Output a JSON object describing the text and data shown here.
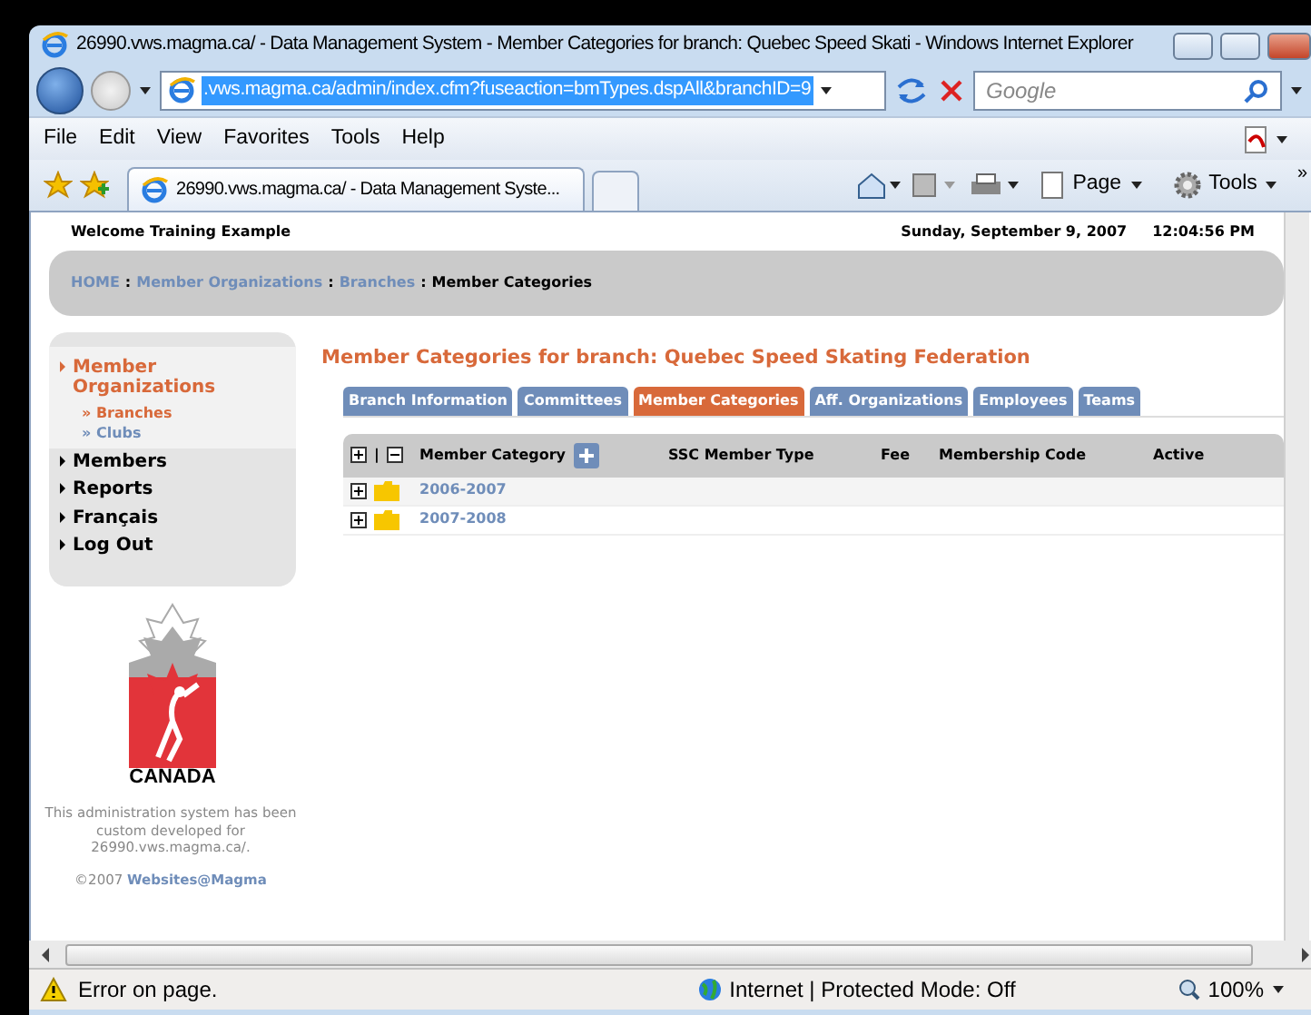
{
  "window": {
    "title": "26990.vws.magma.ca/ - Data Management System - Member Categories for branch: Quebec Speed Skati - Windows Internet Explorer"
  },
  "address_bar": {
    "url": ".vws.magma.ca/admin/index.cfm?fuseaction=bmTypes.dspAll&branchID=9"
  },
  "search": {
    "placeholder": "Google"
  },
  "menu": [
    "File",
    "Edit",
    "View",
    "Favorites",
    "Tools",
    "Help"
  ],
  "browser_tab": {
    "title": "26990.vws.magma.ca/ - Data Management Syste..."
  },
  "command_bar": {
    "page": "Page",
    "tools": "Tools",
    "more": "»"
  },
  "page": {
    "welcome": "Welcome Training Example",
    "date": "Sunday, September 9, 2007",
    "time": "12:04:56 PM",
    "breadcrumb": [
      {
        "label": "HOME",
        "link": true
      },
      {
        "label": "Member Organizations",
        "link": true
      },
      {
        "label": "Branches",
        "link": true
      },
      {
        "label": "Member Categories",
        "link": false
      }
    ],
    "breadcrumb_separator": ":",
    "sidebar": [
      {
        "label": "Member Organizations",
        "selected": true,
        "children": [
          {
            "label": "» Branches",
            "selected": true
          },
          {
            "label": "» Clubs",
            "selected": false
          }
        ]
      },
      {
        "label": "Members",
        "selected": false
      },
      {
        "label": "Reports",
        "selected": false
      },
      {
        "label": "Français",
        "selected": false
      },
      {
        "label": "Log Out",
        "selected": false
      }
    ],
    "logo_text": "CANADA",
    "footer": "This administration system has been custom developed for 26990.vws.magma.ca/.",
    "copyright": "©2007",
    "copyright_link": "Websites@Magma",
    "heading": "Member Categories for branch: Quebec Speed Skating Federation",
    "tabs": [
      {
        "label": "Branch Information",
        "selected": false
      },
      {
        "label": "Committees",
        "selected": false
      },
      {
        "label": "Member Categories",
        "selected": true
      },
      {
        "label": "Aff. Organizations",
        "selected": false
      },
      {
        "label": "Employees",
        "selected": false
      },
      {
        "label": "Teams",
        "selected": false
      }
    ],
    "table": {
      "columns": [
        "Member Category",
        "SSC Member Type",
        "Fee",
        "Membership Code",
        "Active"
      ],
      "expand_separator": "|",
      "rows": [
        {
          "category": "2006-2007"
        },
        {
          "category": "2007-2008"
        }
      ]
    }
  },
  "status_bar": {
    "message": "Error on page.",
    "zone": "Internet | Protected Mode: Off",
    "zoom": "100%"
  }
}
